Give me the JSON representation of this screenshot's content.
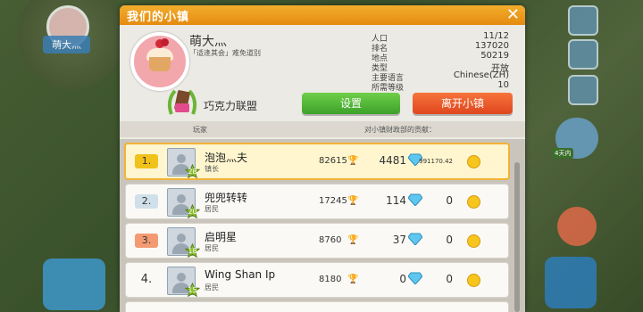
{
  "hud": {
    "left_player_name": "萌大灬",
    "gift_label": "4天内"
  },
  "dialog": {
    "title": "我们的小镇",
    "close_icon": "close-icon"
  },
  "town": {
    "name": "萌大灬",
    "description": "「适逢其会」难免道别",
    "stats": [
      {
        "label": "人口",
        "value": "11/12"
      },
      {
        "label": "排名",
        "value": "137020"
      },
      {
        "label": "地点",
        "value": "50219"
      },
      {
        "label": "类型",
        "value": "开放"
      },
      {
        "label": "主要语言",
        "value": "Chinese(ZH)"
      },
      {
        "label": "所需等级",
        "value": "10"
      }
    ],
    "alliance": "巧克力联盟"
  },
  "buttons": {
    "settings": "设置",
    "leave": "离开小镇"
  },
  "columns": {
    "player": "玩家",
    "contribution": "对小镇财政部的贡献："
  },
  "members": [
    {
      "rank": "1.",
      "level": "28",
      "name": "泡泡灬夫",
      "role": "镇长",
      "points": "82615",
      "gems": "4481",
      "coins": "991170.42"
    },
    {
      "rank": "2.",
      "level": "20",
      "name": "兜兜转转",
      "role": "居民",
      "points": "17245",
      "gems": "114",
      "coins": "0"
    },
    {
      "rank": "3.",
      "level": "18",
      "name": "启明星",
      "role": "居民",
      "points": "8760",
      "gems": "37",
      "coins": "0"
    },
    {
      "rank": "4.",
      "level": "15",
      "name": "Wing Shan Ip",
      "role": "居民",
      "points": "8180",
      "gems": "0",
      "coins": "0"
    }
  ],
  "colors": {
    "titlebar": "#f0a020",
    "settings_button": "#4cb532",
    "leave_button": "#ee5a26",
    "highlight_row": "#fff6cf"
  }
}
